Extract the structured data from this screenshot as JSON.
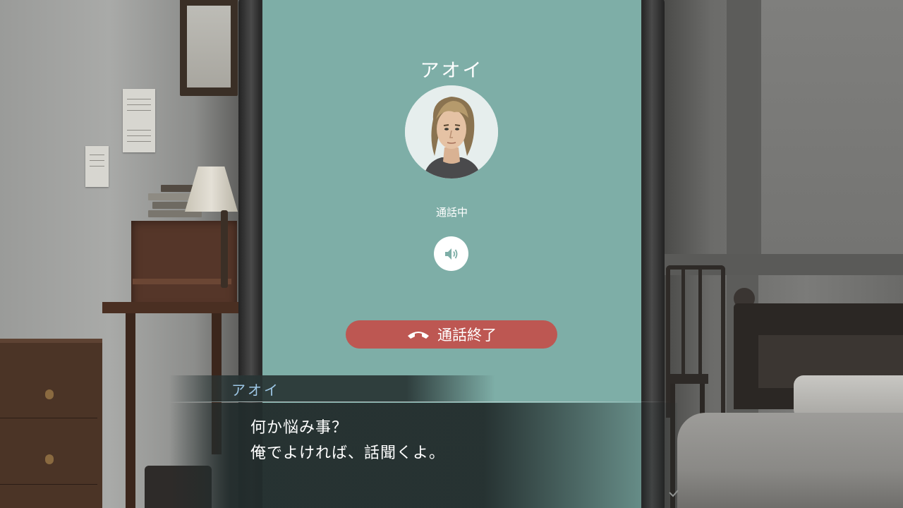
{
  "call": {
    "caller_name": "アオイ",
    "status": "通話中",
    "speaker_icon": "speaker-icon",
    "end_call_label": "通話終了",
    "end_call_icon": "hang-up-icon",
    "screen_color": "#7eaea7",
    "end_call_color": "#bd5752"
  },
  "dialogue": {
    "speaker": "アオイ",
    "lines": [
      "何か悩み事？",
      "俺でよければ、話聞くよ。"
    ],
    "speaker_color": "#9ec7e6",
    "advance_icon": "check-chevron-icon"
  }
}
